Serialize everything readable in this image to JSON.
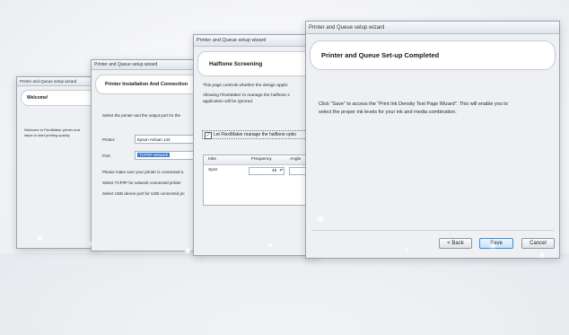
{
  "windows": [
    {
      "title": "Printer and Queue setup wizard",
      "header": "Welcome!",
      "body_lines": [
        "Welcome to FlexiMaker printer and",
        "steps to start printing quickly."
      ]
    },
    {
      "title": "Printer and Queue setup wizard",
      "header": "Printer Installation And Connection",
      "intro": "Select the printer and the output port for the",
      "printer_label": "Printer:",
      "printer_value": "Epson Artisan 143",
      "port_label": "Port:",
      "port_value": "TCP/IP Network",
      "notes": [
        "Please make sure your printer is connected a",
        "Select TCP/IP for network connected printer",
        "Select USB device port for USB connected pri"
      ]
    },
    {
      "title": "Printer and Queue setup wizard",
      "header": "Halftone Screening",
      "desc_lines": [
        "This page controls whether the design applic",
        "Allowing FlexiMaker to manage the halftone s",
        "application will be ignored."
      ],
      "checkbox_label": "Let FlexiMaker manage the halftone optio",
      "table": {
        "headers": [
          "Inks",
          "Frequency",
          "Angle"
        ],
        "rows": [
          {
            "ink": "Spot",
            "frequency": "45",
            "angle": "22"
          }
        ]
      }
    },
    {
      "title": "Printer and Queue setup wizard",
      "header": "Printer and Queue Set-up Completed",
      "message_lines": [
        "Click \"Save\" to access the \"Print Ink Density Test Page Wizard\".  This will enable you to",
        "select the proper ink levels for your ink and media combination."
      ],
      "buttons": {
        "back": "< Back",
        "save": "Save",
        "cancel": "Cancel"
      }
    }
  ]
}
